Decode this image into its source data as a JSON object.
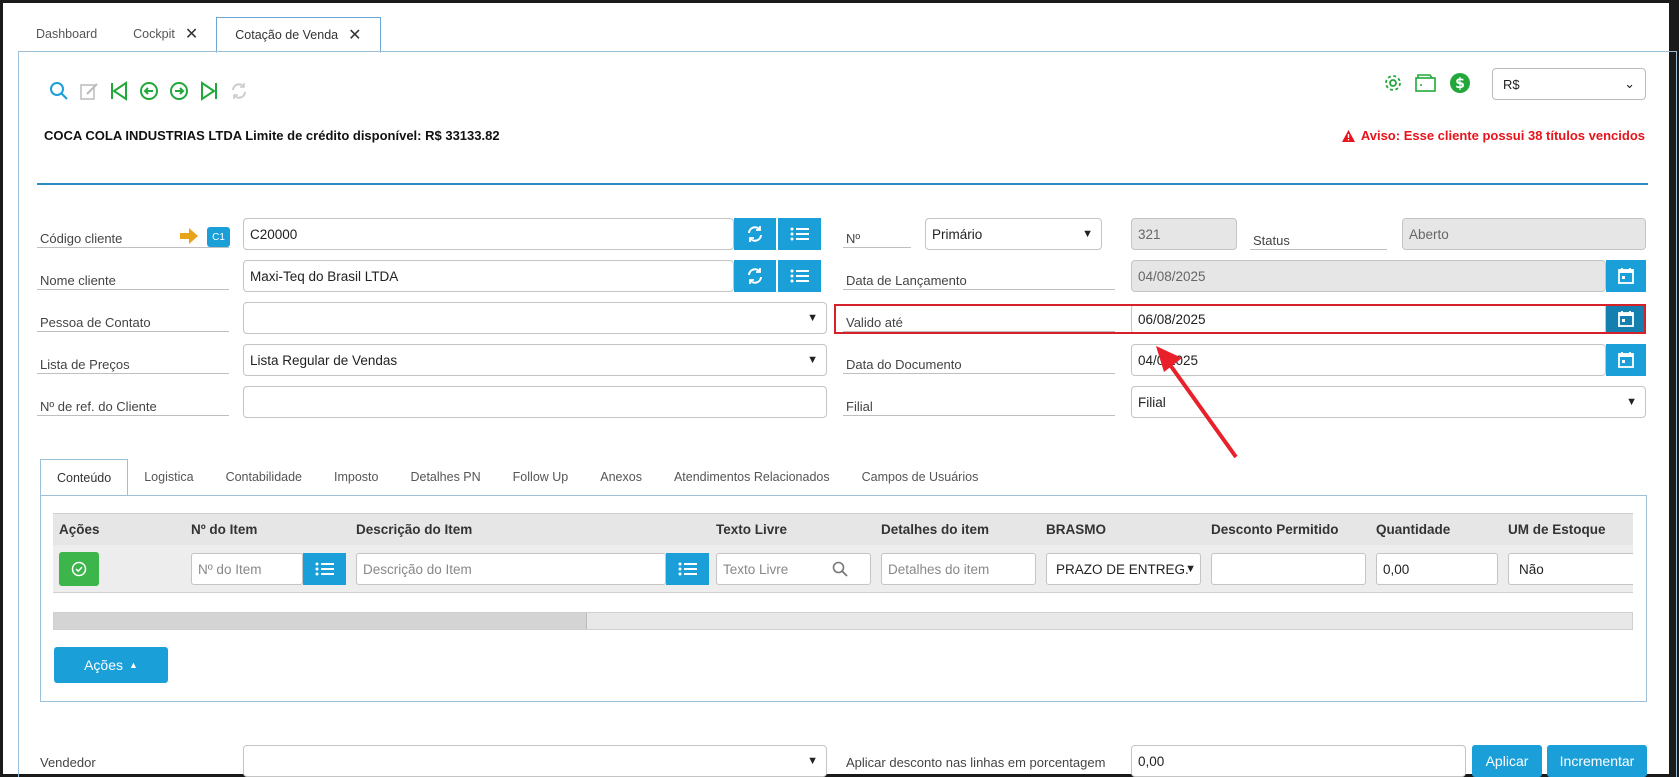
{
  "tabs": [
    {
      "label": "Dashboard",
      "closable": false
    },
    {
      "label": "Cockpit",
      "closable": true
    },
    {
      "label": "Cotação de Venda",
      "closable": true,
      "active": true
    }
  ],
  "toolbar": {
    "icons": [
      "search-icon",
      "edit-icon",
      "first-record-icon",
      "previous-record-icon",
      "next-record-icon",
      "last-record-icon",
      "refresh-icon"
    ]
  },
  "header": {
    "currency": "R$",
    "company_line": "COCA COLA INDUSTRIAS LTDA Limite de crédito disponível: R$ 33133.82",
    "warning": "Aviso: Esse cliente possui 38 títulos vencidos"
  },
  "form": {
    "codigo_cliente_label": "Código cliente",
    "codigo_cliente_badge": "C1",
    "codigo_cliente_value": "C20000",
    "nome_cliente_label": "Nome cliente",
    "nome_cliente_value": "Maxi-Teq do Brasil LTDA",
    "pessoa_contato_label": "Pessoa de Contato",
    "pessoa_contato_value": "",
    "lista_precos_label": "Lista de Preços",
    "lista_precos_value": "Lista Regular de Vendas",
    "ref_cliente_label": "Nº de ref. do Cliente",
    "ref_cliente_value": "",
    "numero_label": "Nº",
    "numero_serie": "Primário",
    "numero_value": "321",
    "status_label": "Status",
    "status_value": "Aberto",
    "data_lancamento_label": "Data de Lançamento",
    "data_lancamento_value": "04/08/2025",
    "valido_ate_label": "Valido até",
    "valido_ate_value": "06/08/2025",
    "data_documento_label": "Data do Documento",
    "data_documento_value": "04/0 2025",
    "filial_label": "Filial",
    "filial_value": "Filial"
  },
  "subtabs": [
    "Conteúdo",
    "Logistica",
    "Contabilidade",
    "Imposto",
    "Detalhes PN",
    "Follow Up",
    "Anexos",
    "Atendimentos Relacionados",
    "Campos de Usuários"
  ],
  "grid": {
    "headers": [
      "Ações",
      "Nº do Item",
      "Descrição do Item",
      "Texto Livre",
      "Detalhes do item",
      "BRASMO",
      "Desconto Permitido",
      "Quantidade",
      "UM de Estoque"
    ],
    "row": {
      "item_placeholder": "Nº do Item",
      "descricao_placeholder": "Descrição do Item",
      "texto_livre_placeholder": "Texto Livre",
      "detalhes_placeholder": "Detalhes do item",
      "brasmo_value": "PRAZO DE ENTREG.",
      "desconto_value": "",
      "quantidade_value": "0,00",
      "um_estoque_value": "Não"
    }
  },
  "acoes_button": "Ações",
  "bottom": {
    "vendedor_label": "Vendedor",
    "desconto_label": "Aplicar desconto nas linhas em porcentagem",
    "desconto_value": "0,00",
    "aplicar_button": "Aplicar",
    "incrementar_button": "Incrementar"
  },
  "colors": {
    "accent": "#1a9fd9",
    "warning": "#e8131b",
    "highlight": "#d6202a",
    "arrow": "#e8202a",
    "toolbar_icon": "#1a9fd9",
    "green_icon": "#22a83a"
  }
}
